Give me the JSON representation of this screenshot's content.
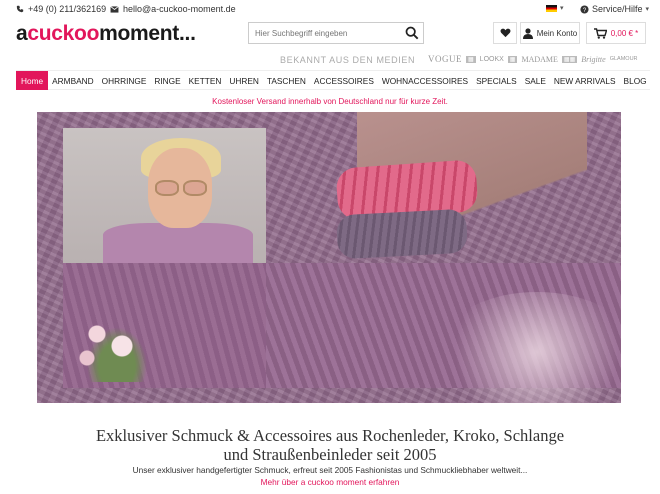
{
  "topbar": {
    "phone": "+49 (0) 211/362169",
    "email": "hello@a-cuckoo-moment.de",
    "language_icon": "flag-de-icon",
    "service": "Service/Hilfe"
  },
  "logo": {
    "part1": "a",
    "part2": "cuckoo",
    "part3": "moment..."
  },
  "search": {
    "placeholder": "Hier Suchbegriff eingeben"
  },
  "header": {
    "account_label": "Mein Konto",
    "cart_total": "0,00 € *"
  },
  "press": {
    "heading": "BEKANNT AUS DEN MEDIEN",
    "logos": [
      "VOGUE",
      "LOOKX",
      "MADAME",
      "Brigitte",
      "GLAMOUR"
    ]
  },
  "nav": {
    "items": [
      "Home",
      "ARMBAND",
      "OHRRINGE",
      "RINGE",
      "KETTEN",
      "UHREN",
      "TASCHEN",
      "ACCESSOIRES",
      "WOHNACCESSOIRES",
      "SPECIALS",
      "SALE",
      "NEW ARRIVALS",
      "BLOG"
    ]
  },
  "shipping_notice": "Kostenloser Versand innerhalb von Deutschland nur für kurze Zeit.",
  "hero": {
    "headline_line1": "Exklusiver Schmuck & Accessoires aus Rochenleder, Kroko, Schlange",
    "headline_line2": "und Straußenbeinleder seit 2005",
    "subline": "Unser exklusiver handgefertigter Schmuck, erfreut seit 2005 Fashionistas und Schmuckliebhaber weltweit...",
    "more_link": "Mehr über a cuckoo moment erfahren"
  },
  "colors": {
    "accent": "#e2165b"
  }
}
